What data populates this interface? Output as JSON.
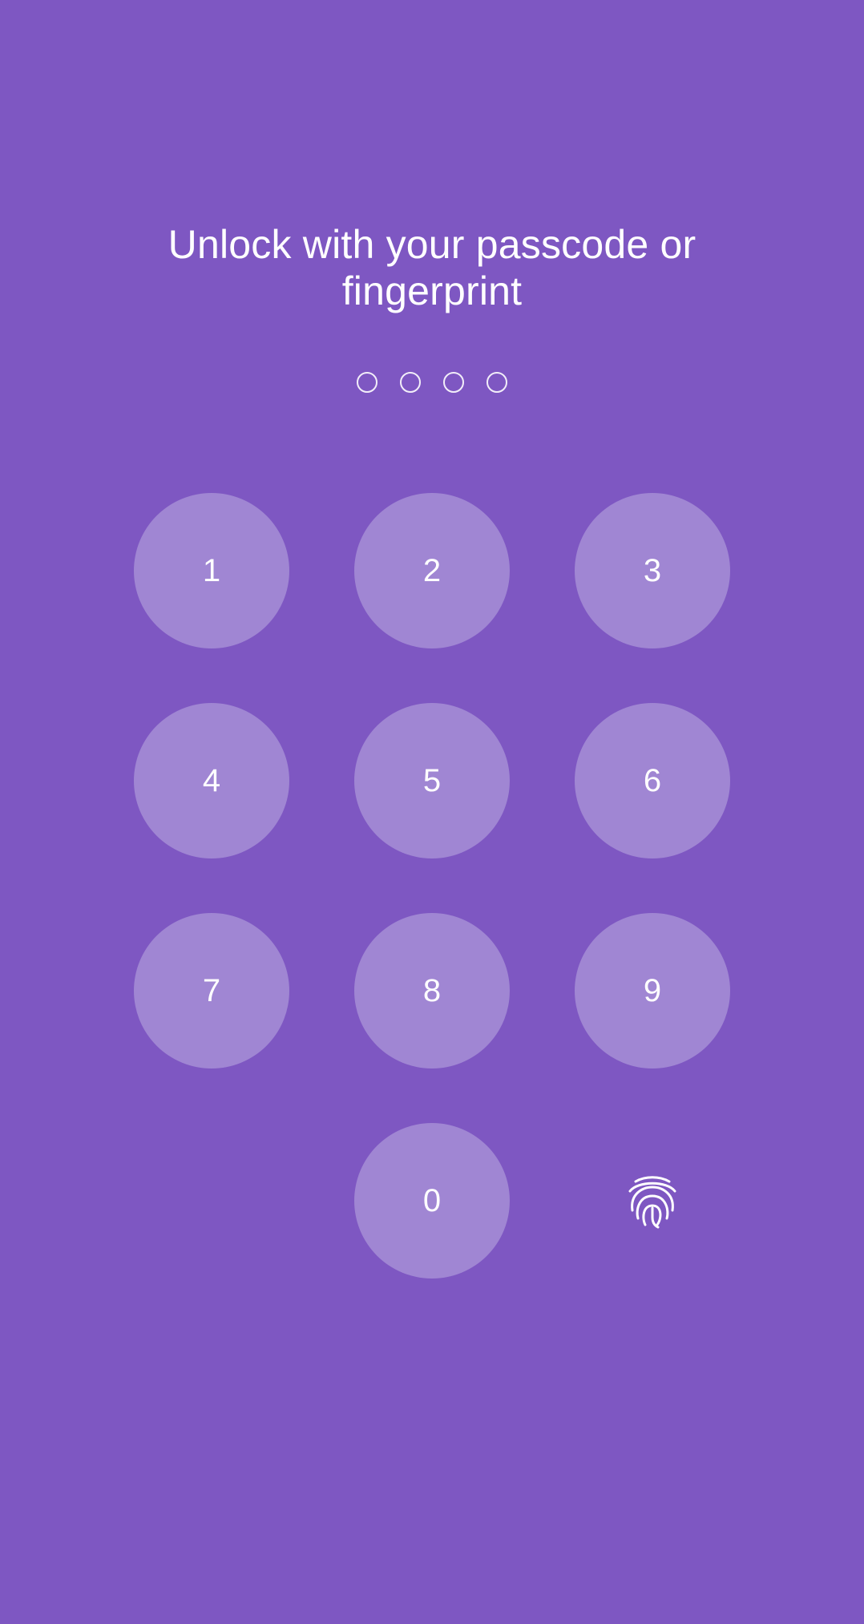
{
  "lock": {
    "title": "Unlock with your passcode or fingerprint",
    "passcode_length": 4,
    "keys": [
      "1",
      "2",
      "3",
      "4",
      "5",
      "6",
      "7",
      "8",
      "9",
      "0"
    ],
    "fingerprint_icon": "fingerprint-icon",
    "colors": {
      "background": "#7e57c2",
      "key_fill": "#a086d3",
      "text": "#ffffff"
    }
  }
}
